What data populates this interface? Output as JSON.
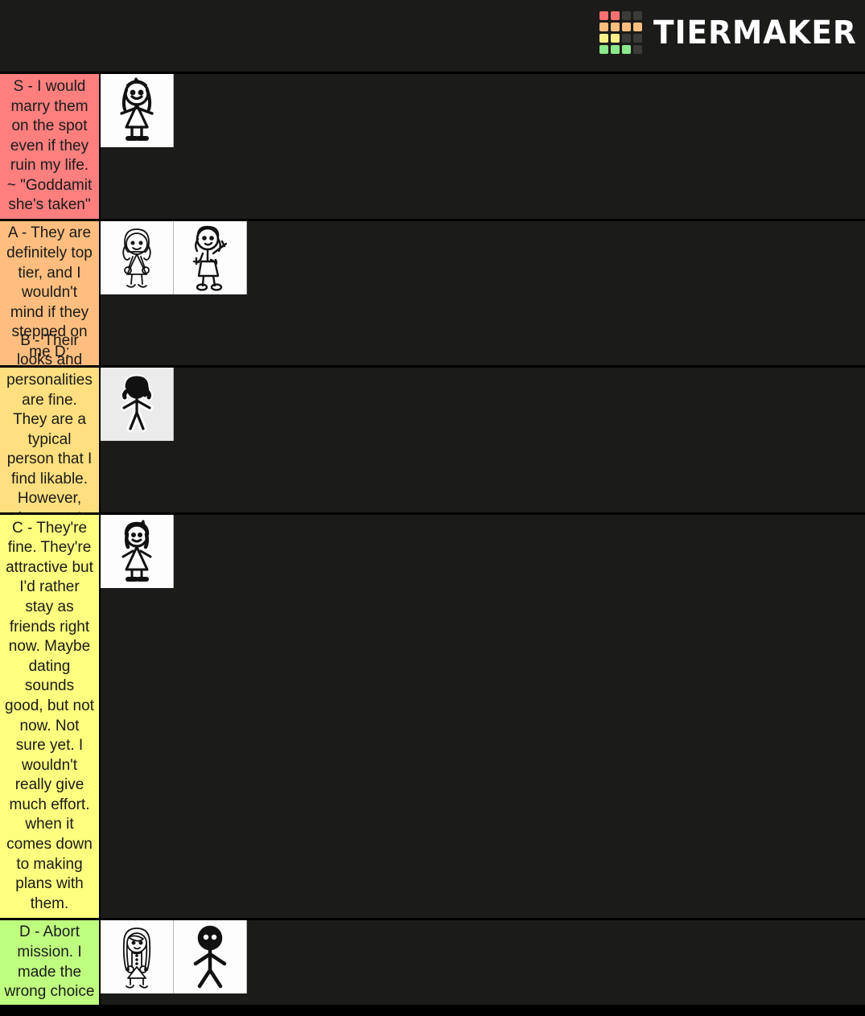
{
  "app": {
    "brand_name": "TIERMAKER",
    "background_color": "#1b1b19",
    "separator_color": "#000000"
  },
  "logo": {
    "name": "tiermaker-logo",
    "grid_colors": [
      "#f87171",
      "#f87171",
      "#3b3b38",
      "#3b3b38",
      "#f9bd7e",
      "#f9bd7e",
      "#f9bd7e",
      "#f9bd7e",
      "#f7f08a",
      "#f7f08a",
      "#3b3b38",
      "#3b3b38",
      "#8ce88c",
      "#8ce88c",
      "#8ce88c",
      "#3b3b38"
    ]
  },
  "tiers": [
    {
      "id": "S",
      "label": "S - I would marry them on the spot even if they ruin my life. ~ \"Goddamit she's taken\"",
      "color": "#ff7f7f",
      "items": [
        {
          "name": "stick-figure-girl-pigtails-dress",
          "bg": "white"
        }
      ]
    },
    {
      "id": "A",
      "label": "A - They are definitely top tier, and I wouldn't mind if they stepped on me D:",
      "color": "#ffbe7f",
      "items": [
        {
          "name": "stick-figure-girl-bob-hair-dress",
          "bg": "white"
        },
        {
          "name": "stick-figure-girl-waving-dress",
          "bg": "white"
        }
      ]
    },
    {
      "id": "B",
      "label": "B - Their looks and personalities are fine. They are a typical person that I find likable. However, they aren't toxic.",
      "color": "#ffdf7f",
      "items": [
        {
          "name": "stick-figure-girl-outline-sticker",
          "bg": "gray"
        }
      ]
    },
    {
      "id": "C",
      "label": "C - They're fine. They're attractive but I'd rather stay as friends right now. Maybe dating sounds good, but not now. Not sure yet. I wouldn't really give much effort. when it comes down to making plans with them.",
      "color": "#ffff7f",
      "items": [
        {
          "name": "stick-figure-girl-bangs-dress",
          "bg": "white"
        }
      ]
    },
    {
      "id": "D",
      "label": "D - Abort mission. I made the wrong choice",
      "color": "#bfff7f",
      "items": [
        {
          "name": "stick-figure-girl-long-hair-dress",
          "bg": "white"
        },
        {
          "name": "stick-figure-person-plain",
          "bg": "white"
        }
      ]
    }
  ]
}
